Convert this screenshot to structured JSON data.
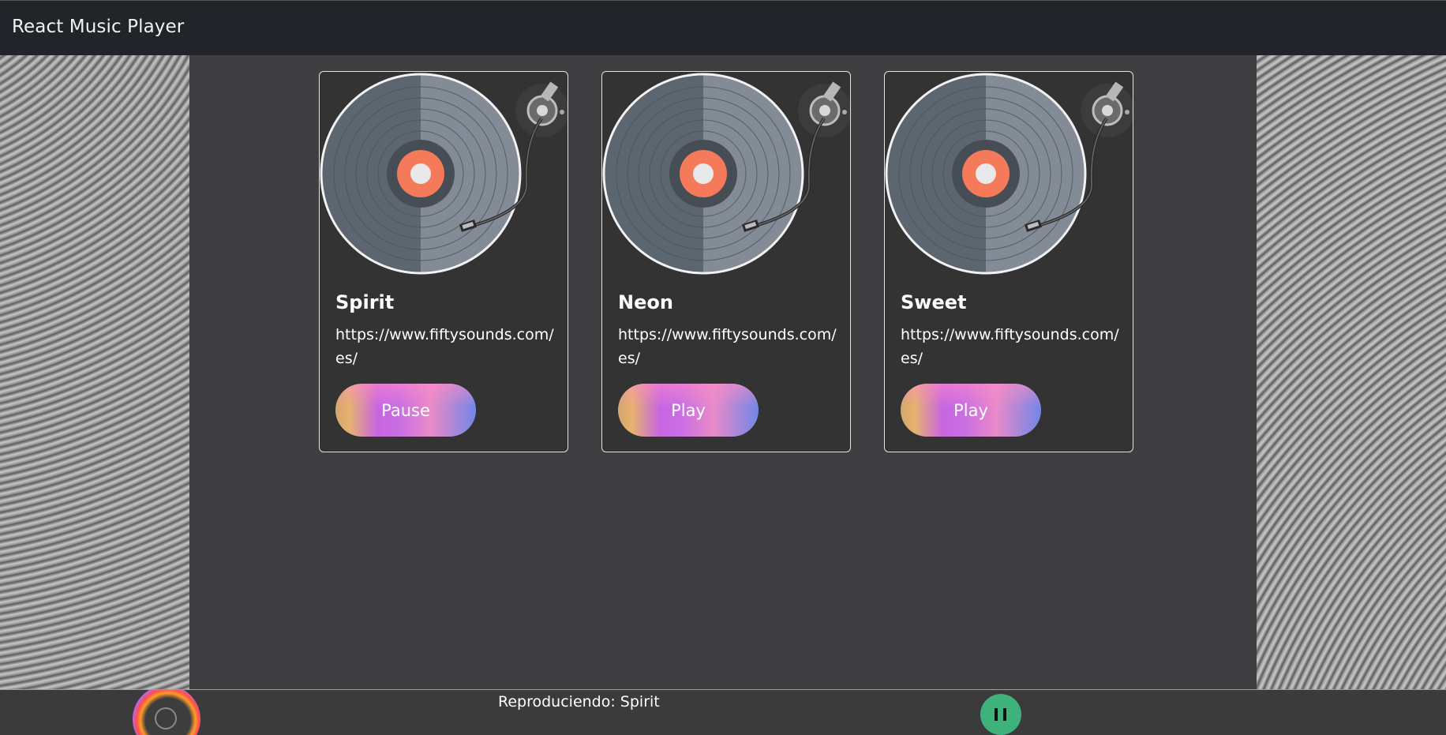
{
  "app": {
    "title": "React Music Player"
  },
  "songs": [
    {
      "title": "Spirit",
      "url": "https://www.fiftysounds.com/es/",
      "button_label": "Pause"
    },
    {
      "title": "Neon",
      "url": "https://www.fiftysounds.com/es/",
      "button_label": "Play"
    },
    {
      "title": "Sweet",
      "url": "https://www.fiftysounds.com/es/",
      "button_label": "Play"
    }
  ],
  "player": {
    "now_playing": "Reproduciendo: Spirit",
    "state": "playing"
  },
  "colors": {
    "navbar": "#212529",
    "background": "#3f3f41",
    "card": "#333334",
    "record_accent": "#f47a5a",
    "pause_button": "#3fb27b"
  },
  "icons": {
    "card_image": "turntable-vinyl-icon",
    "player_disc": "spinning-disc-icon",
    "player_control": "pause-icon"
  }
}
